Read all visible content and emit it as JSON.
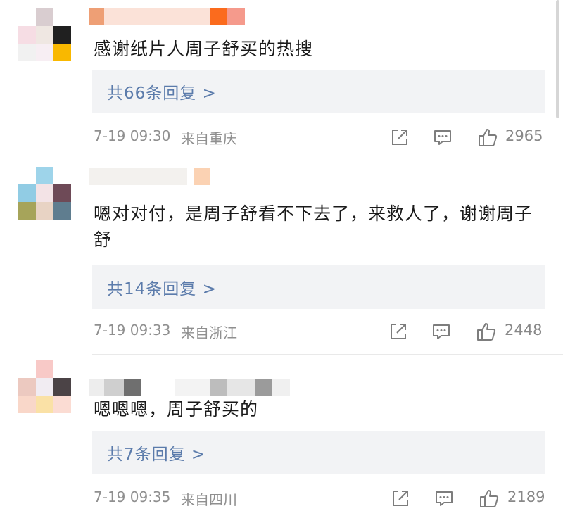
{
  "colors": {
    "link": "#5b7bab",
    "meta": "#8f8f8f",
    "reply_bg": "#f2f3f5"
  },
  "comments": [
    {
      "text": "感谢纸片人周子舒买的热搜",
      "replies": "共66条回复 >",
      "time": "7-19 09:30",
      "location": "来自重庆",
      "likes": "2965",
      "icons": [
        "share-icon",
        "comment-icon",
        "like-icon"
      ]
    },
    {
      "text": "嗯对对付，是周子舒看不下去了，来救人了，谢谢周子舒",
      "replies": "共14条回复 >",
      "time": "7-19 09:33",
      "location": "来自浙江",
      "likes": "2448",
      "icons": [
        "share-icon",
        "comment-icon",
        "like-icon"
      ]
    },
    {
      "text": "嗯嗯嗯，周子舒买的",
      "replies": "共7条回复 >",
      "time": "7-19 09:35",
      "location": "来自四川",
      "likes": "2189",
      "icons": [
        "share-icon",
        "comment-icon",
        "like-icon"
      ]
    }
  ]
}
